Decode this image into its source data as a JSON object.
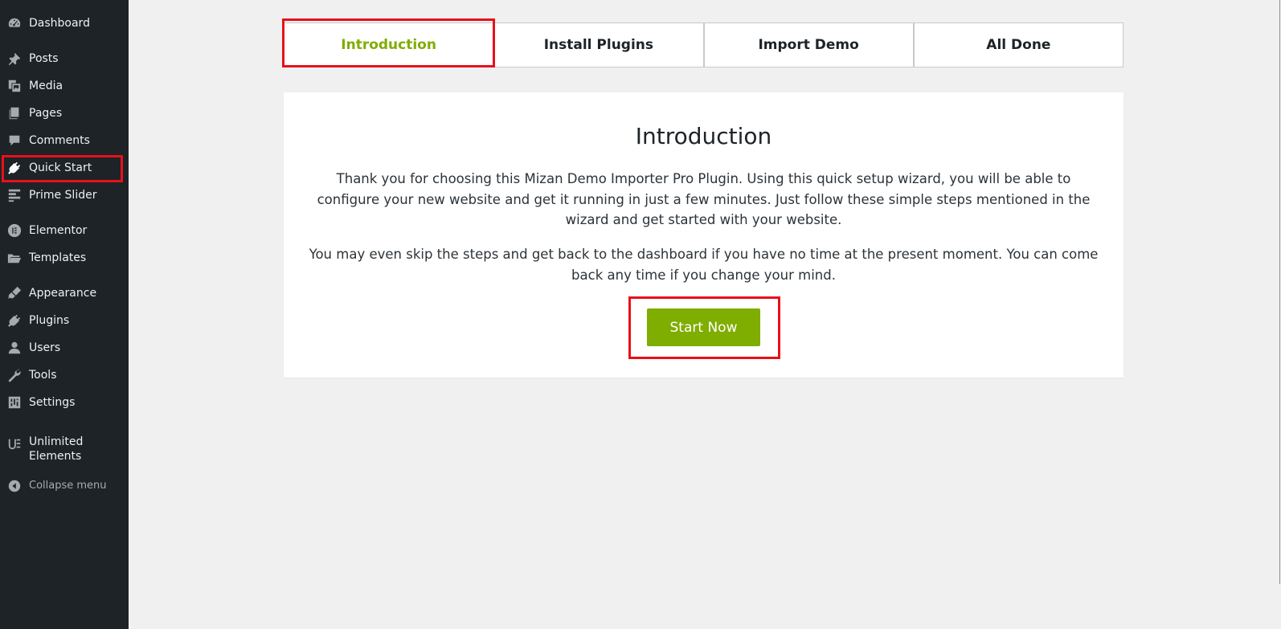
{
  "sidebar": {
    "items": [
      {
        "label": "Dashboard",
        "icon": "dashboard-icon"
      },
      {
        "label": "Posts",
        "icon": "pushpin-icon"
      },
      {
        "label": "Media",
        "icon": "media-icon"
      },
      {
        "label": "Pages",
        "icon": "pages-icon"
      },
      {
        "label": "Comments",
        "icon": "comment-icon"
      },
      {
        "label": "Quick Start",
        "icon": "plugin-plug-icon"
      },
      {
        "label": "Prime Slider",
        "icon": "prime-slider-icon"
      },
      {
        "label": "Elementor",
        "icon": "elementor-icon"
      },
      {
        "label": "Templates",
        "icon": "folder-icon"
      },
      {
        "label": "Appearance",
        "icon": "paintbrush-icon"
      },
      {
        "label": "Plugins",
        "icon": "plugin-plug-icon"
      },
      {
        "label": "Users",
        "icon": "user-icon"
      },
      {
        "label": "Tools",
        "icon": "wrench-icon"
      },
      {
        "label": "Settings",
        "icon": "settings-sliders-icon"
      },
      {
        "label": "Unlimited Elements",
        "icon": "unlimited-elements-icon"
      }
    ],
    "collapse_label": "Collapse menu"
  },
  "wizard": {
    "tabs": [
      {
        "label": "Introduction",
        "active": true
      },
      {
        "label": "Install Plugins",
        "active": false
      },
      {
        "label": "Import Demo",
        "active": false
      },
      {
        "label": "All Done",
        "active": false
      }
    ],
    "title": "Introduction",
    "paragraph1": "Thank you for choosing this Mizan Demo Importer Pro Plugin. Using this quick setup wizard, you will be able to configure your new website and get it running in just a few minutes. Just follow these simple steps mentioned in the wizard and get started with your website.",
    "paragraph2": "You may even skip the steps and get back to the dashboard if you have no time at the present moment. You can come back any time if you change your mind.",
    "start_button": "Start Now"
  },
  "colors": {
    "sidebar_bg": "#1d2327",
    "accent_green": "#7fad00",
    "highlight_red": "#e8101a"
  }
}
